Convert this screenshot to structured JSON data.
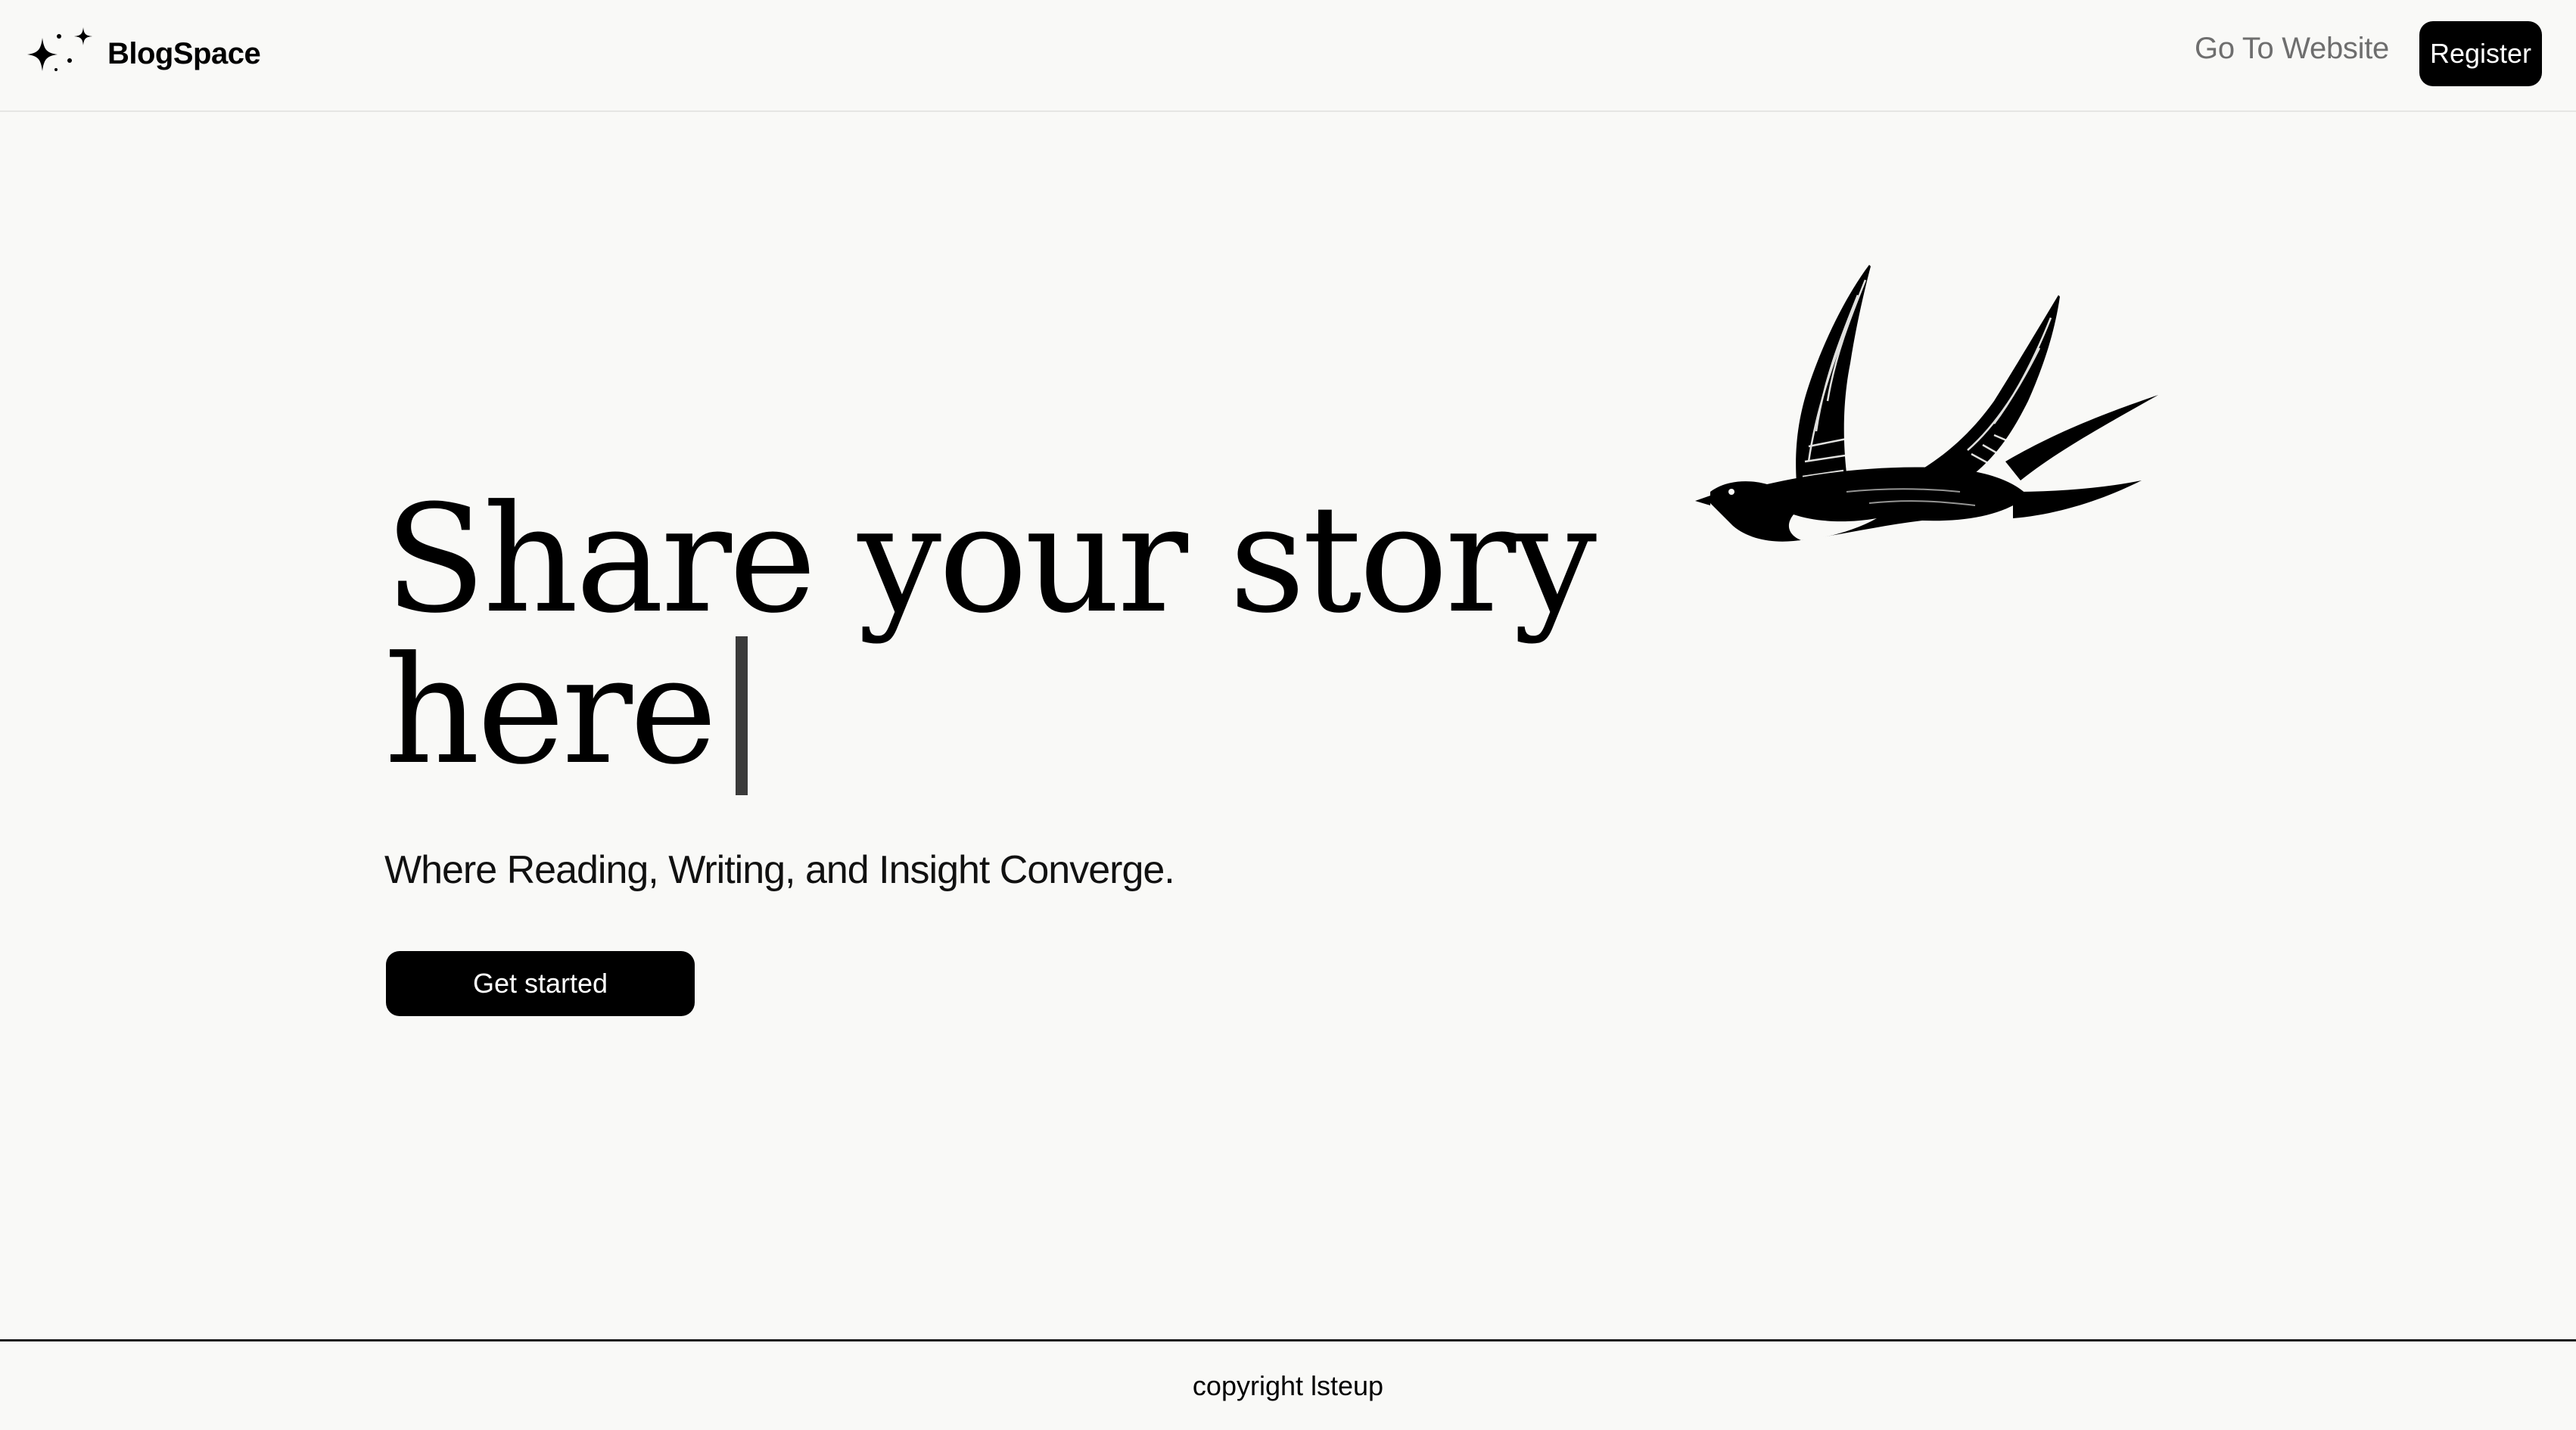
{
  "header": {
    "brand": "BlogSpace",
    "brand_icon": "sparkles-icon",
    "nav_link": "Go To Website",
    "register_label": "Register"
  },
  "hero": {
    "title": "Share your story here",
    "subtitle": "Where Reading, Writing, and Insight Converge.",
    "cta_label": "Get started",
    "illustration": "swallow-bird-illustration"
  },
  "footer": {
    "text": "copyright lsteup"
  }
}
